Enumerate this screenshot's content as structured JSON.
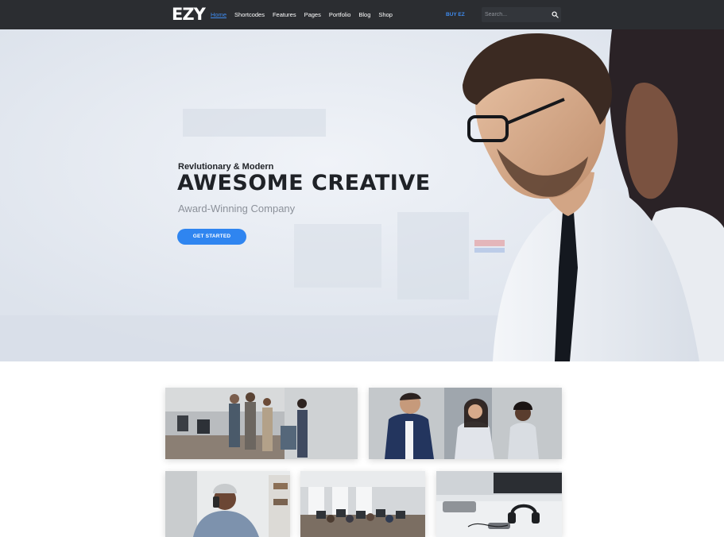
{
  "nav": {
    "logo": "EZY",
    "items": [
      {
        "label": "Home",
        "active": true
      },
      {
        "label": "Shortcodes",
        "active": false
      },
      {
        "label": "Features",
        "active": false
      },
      {
        "label": "Pages",
        "active": false
      },
      {
        "label": "Portfolio",
        "active": false
      },
      {
        "label": "Blog",
        "active": false
      },
      {
        "label": "Shop",
        "active": false
      }
    ],
    "buy_label": "BUY EZ",
    "search_placeholder": "Search...",
    "search_icon": "search-icon"
  },
  "hero": {
    "subtitle": "Revlutionary & Modern",
    "title": "AWESOME CREATIVE",
    "tagline": "Award-Winning Company",
    "cta_label": "GET STARTED"
  },
  "gallery": {
    "images": [
      "team-office-photo",
      "business-meeting-photo",
      "man-on-phone-photo",
      "open-office-photo",
      "headphones-desk-photo"
    ]
  },
  "colors": {
    "navbar": "#2b2d31",
    "accent": "#2f85f0",
    "text_dark": "#1f2227"
  }
}
